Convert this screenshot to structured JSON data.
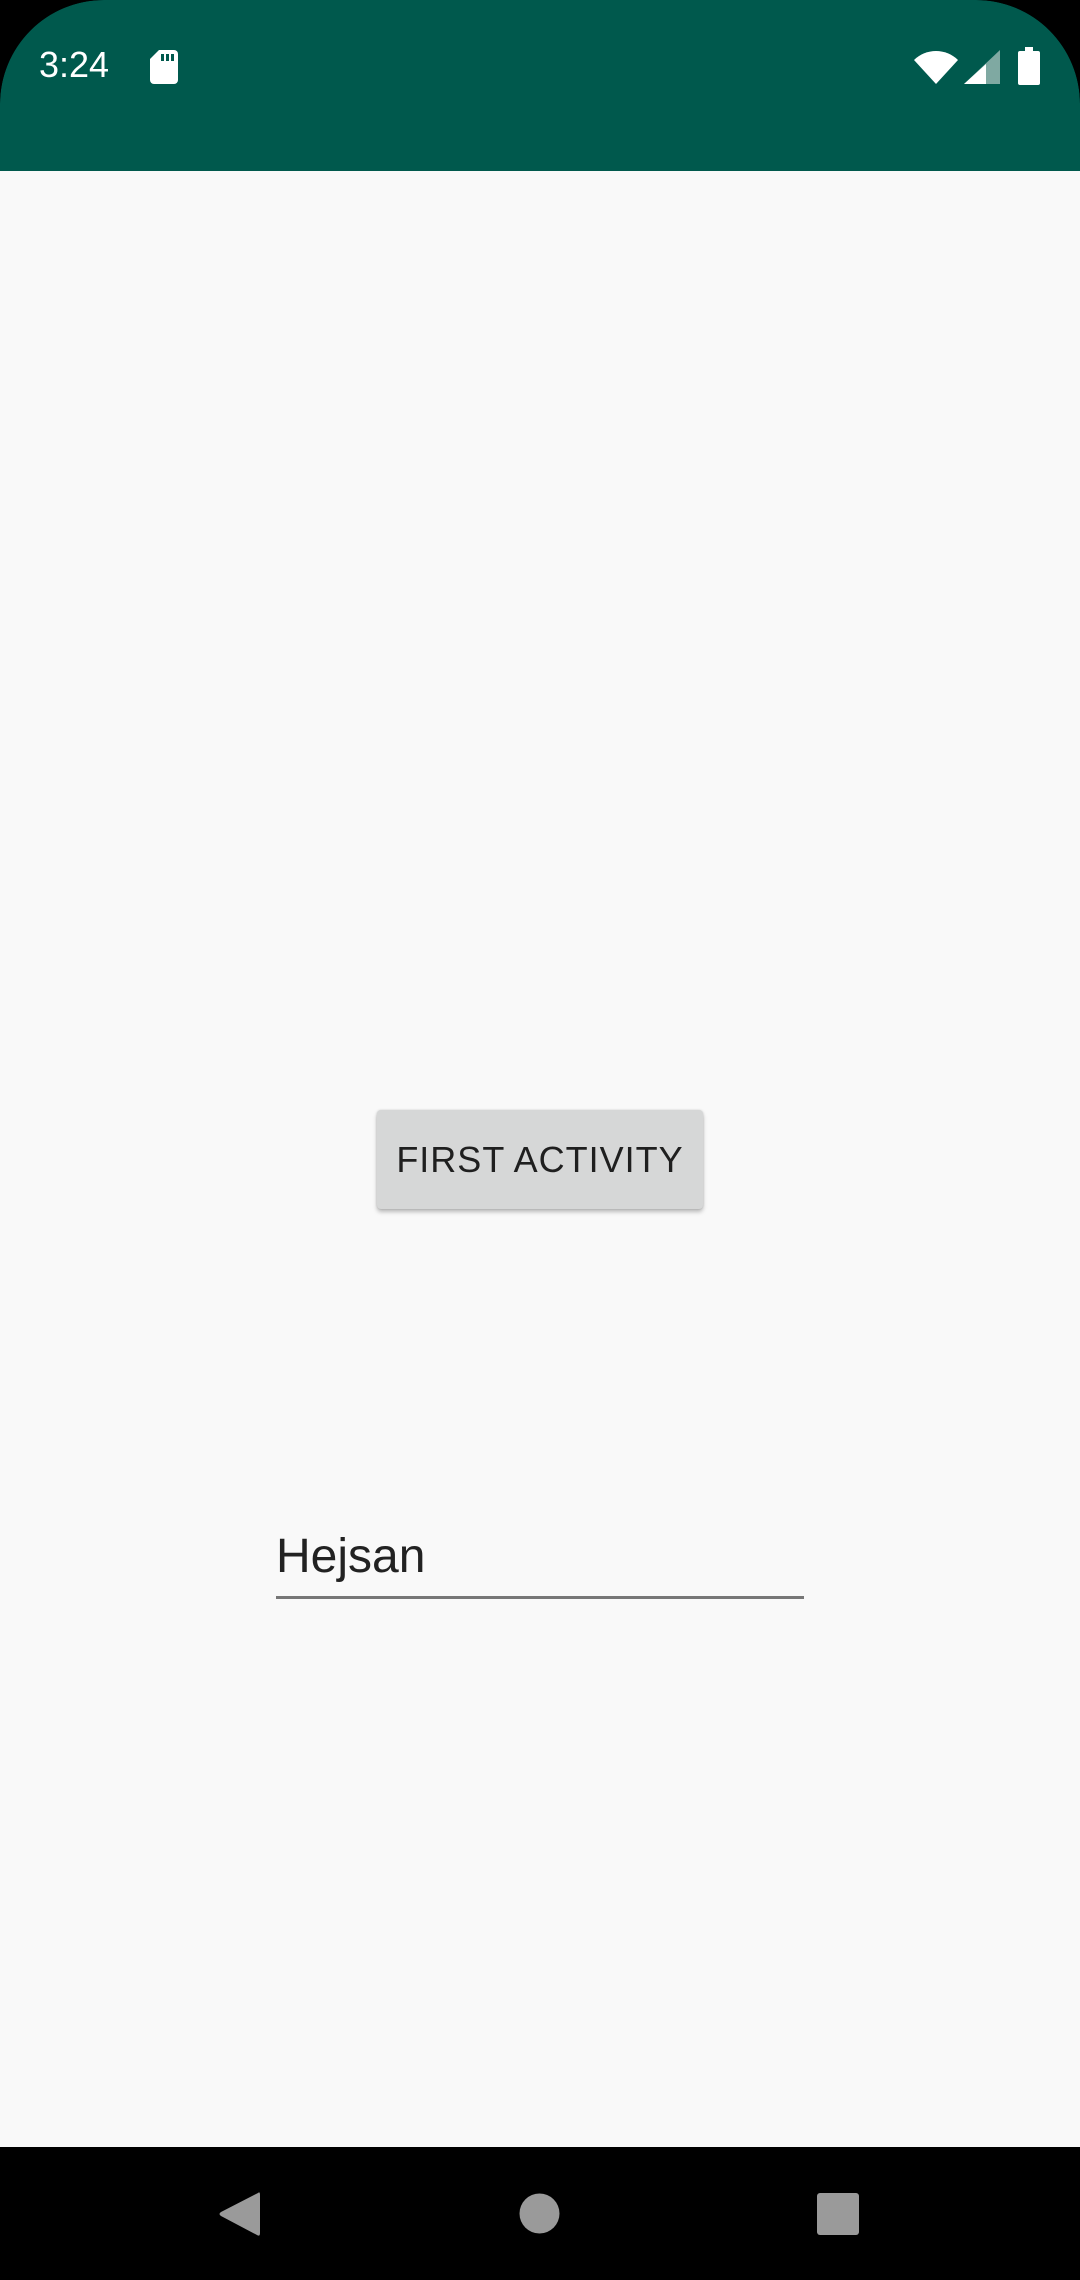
{
  "status_bar": {
    "time": "3:24",
    "background_color": "#00594d",
    "icons": [
      "sd-card-icon",
      "wifi-icon",
      "cellular-signal-icon",
      "battery-icon"
    ]
  },
  "main": {
    "button_label": "FIRST ACTIVITY",
    "text_field_value": "Hejsan",
    "background_color": "#f9f9f9"
  },
  "nav_bar": {
    "icons": [
      "back-icon",
      "home-icon",
      "recents-icon"
    ]
  }
}
